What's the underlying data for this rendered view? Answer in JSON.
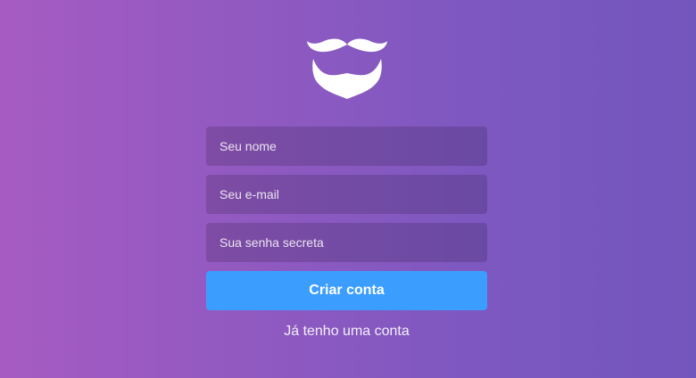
{
  "logo": {
    "icon": "mustache-beard-icon",
    "color": "#ffffff"
  },
  "form": {
    "name_placeholder": "Seu nome",
    "email_placeholder": "Seu e-mail",
    "password_placeholder": "Sua senha secreta",
    "submit_label": "Criar conta",
    "signin_link": "Já tenho uma conta"
  },
  "colors": {
    "background_start": "#a65bc2",
    "background_end": "#7356bd",
    "button": "#3b9eff"
  }
}
